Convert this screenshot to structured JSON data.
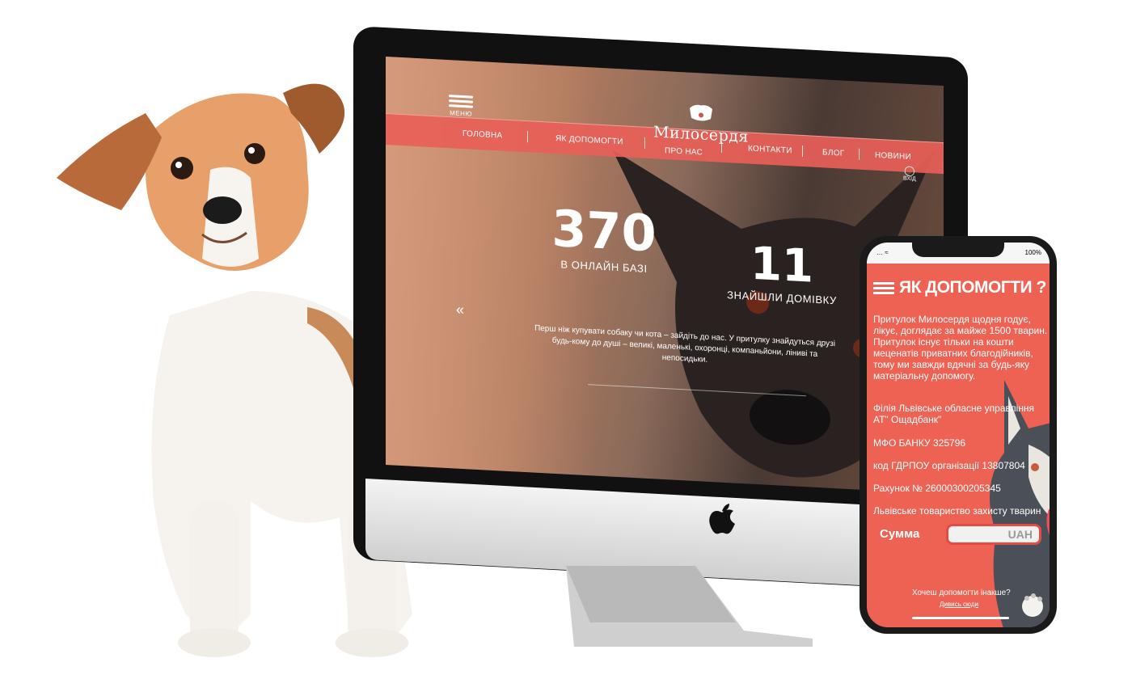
{
  "desktop": {
    "menu_label": "МЕНЮ",
    "logo_text": "Милосердя",
    "nav": [
      "ГОЛОВНА",
      "ЯК ДОПОМОГТИ",
      "ПРО НАС",
      "КОНТАКТИ",
      "БЛОГ",
      "НОВИНИ"
    ],
    "login_label": "ВХІД",
    "stat1": {
      "value": "370",
      "caption": "В ОНЛАЙН БАЗІ"
    },
    "stat2": {
      "value": "11",
      "caption": "ЗНАЙШЛИ ДОМІВКУ"
    },
    "prev_arrow": "«",
    "intro": "Перш ніж купувати собаку чи кота – зайдіть до нас. У притулку знайдуться друзі будь-кому до душі – великі, маленькі, охоронці, компаньйони, ліниві та непосидьки."
  },
  "phone": {
    "battery": "100%",
    "heading": "ЯК ДОПОМОГТИ ?",
    "paragraph": "Притулок Милосердя щодня годує, лікує, доглядає за майже 1500 тварин. Притулок існує тільки на кошти меценатів приватних благодійників, тому ми завжди вдячні за будь-яку матеріальну допомогу.",
    "bank_branch": "Філія Львівське обласне управління АТ\" Ощадбанк\"",
    "mfo": "МФО БАНКУ 325796",
    "edrpou": "код ГДРПОУ організації 13807804",
    "account": "Рахунок № 26000300205345",
    "org": "Львівське товариство захисту тварин",
    "sum_label": "Сумма",
    "currency": "UAH",
    "help_question": "Хочеш допомогти інакше?",
    "help_link": "Дивись сюди"
  },
  "colors": {
    "accent": "#ee6254",
    "dark": "#111111"
  }
}
